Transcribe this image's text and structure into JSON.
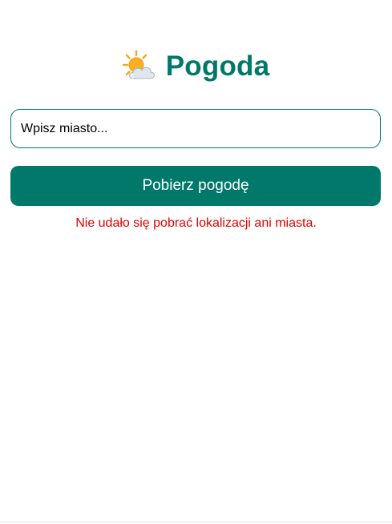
{
  "app": {
    "title": "Pogoda",
    "icon": "sun-behind-cloud-icon"
  },
  "search": {
    "placeholder": "Wpisz miasto...",
    "value": ""
  },
  "actions": {
    "fetch_label": "Pobierz pogodę"
  },
  "status": {
    "error": "Nie udało się pobrać lokalizacji ani miasta."
  },
  "colors": {
    "accent": "#00796b",
    "error": "#e60000",
    "background": "#ffffff"
  }
}
